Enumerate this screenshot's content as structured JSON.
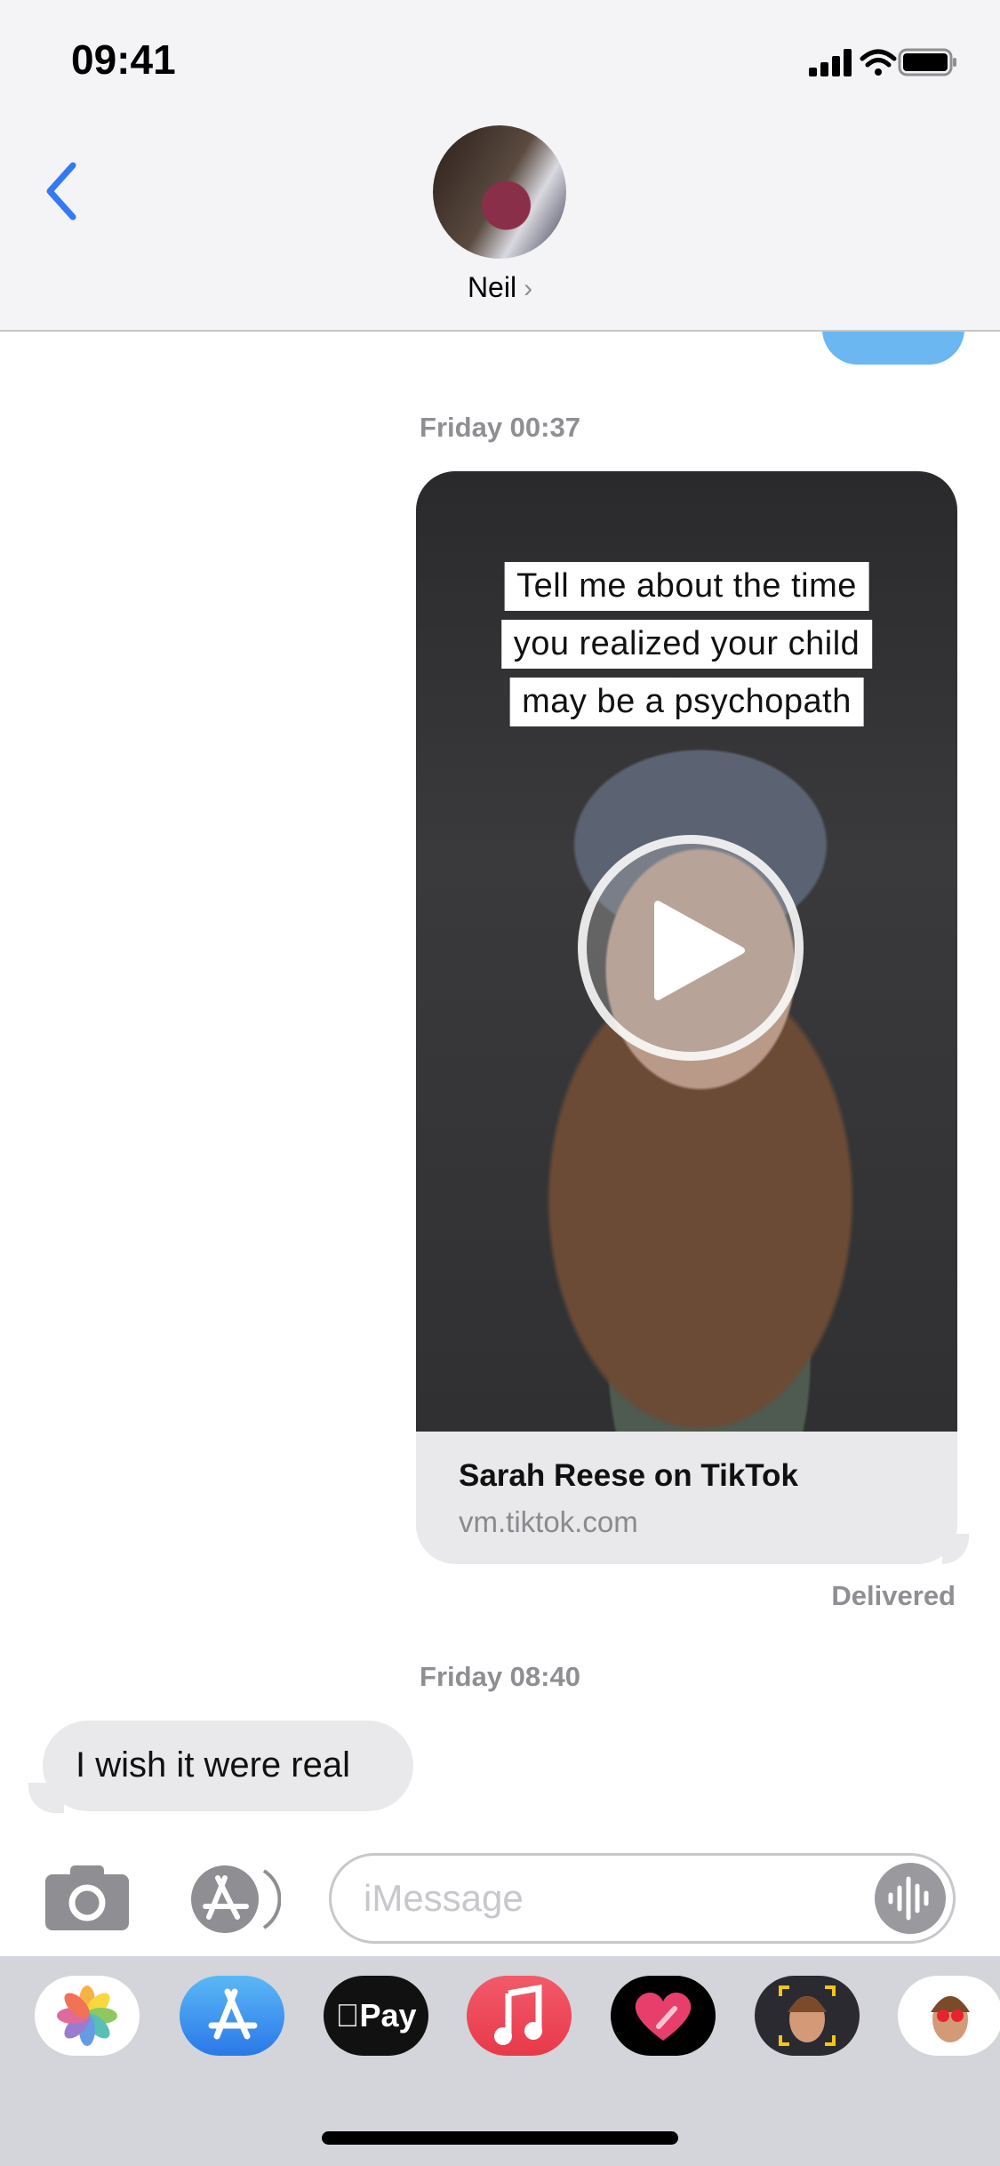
{
  "status_bar": {
    "time": "09:41",
    "icons": [
      "cellular-signal-icon",
      "wifi-icon",
      "battery-icon"
    ]
  },
  "header": {
    "contact_name": "Neil",
    "chevron": "›",
    "back_icon": "chevron-left-icon",
    "accent": "#3478f6"
  },
  "messages": [
    {
      "type": "timestamp",
      "text": "Friday 00:37"
    },
    {
      "type": "link_preview",
      "direction": "sent",
      "caption_lines": [
        "Tell me about the time",
        "you realized your child",
        "may be a psychopath"
      ],
      "title": "Sarah Reese on TikTok",
      "domain": "vm.tiktok.com",
      "status": "Delivered"
    },
    {
      "type": "timestamp",
      "text": "Friday 08:40"
    },
    {
      "type": "text",
      "direction": "received",
      "text": "I wish it were real"
    }
  ],
  "composer": {
    "placeholder": "iMessage",
    "value": ""
  },
  "app_tray": [
    "photos",
    "app-store",
    "apple-pay",
    "music",
    "digital-touch",
    "memoji",
    "memoji-stickers"
  ],
  "colors": {
    "sent_bubble": "#6ab7f2",
    "received_bubble": "#e9e9eb",
    "tray": "#d3d5da"
  }
}
